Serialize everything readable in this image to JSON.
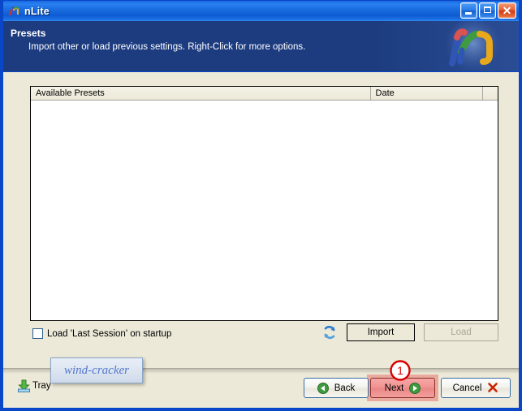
{
  "window": {
    "title": "nLite",
    "icon": "nlite-logo-icon",
    "caption_buttons": [
      {
        "name": "minimize",
        "label": "_"
      },
      {
        "name": "maximize",
        "label": "□"
      },
      {
        "name": "close",
        "label": "✕"
      }
    ]
  },
  "header": {
    "title": "Presets",
    "subtitle": "Import other or load previous settings. Right-Click for more options.",
    "logo": "nlite-large-logo-icon",
    "bg_color": "#1d3c80"
  },
  "list": {
    "columns": [
      {
        "label": "Available Presets"
      },
      {
        "label": "Date"
      },
      {
        "label": ""
      }
    ],
    "rows": []
  },
  "options": {
    "load_last_session_label": "Load 'Last Session' on startup",
    "load_last_session_checked": false,
    "refresh_icon": "refresh-icon"
  },
  "actions": {
    "import_label": "Import",
    "load_label": "Load",
    "load_enabled": false
  },
  "footer": {
    "tray_label": "Tray",
    "tray_icon": "tray-download-icon",
    "watermark": "wind-cracker",
    "back_label": "Back",
    "next_label": "Next",
    "cancel_label": "Cancel"
  },
  "annotation": {
    "badge_number": "1",
    "badge_color": "#d80000",
    "target": "next-button"
  }
}
